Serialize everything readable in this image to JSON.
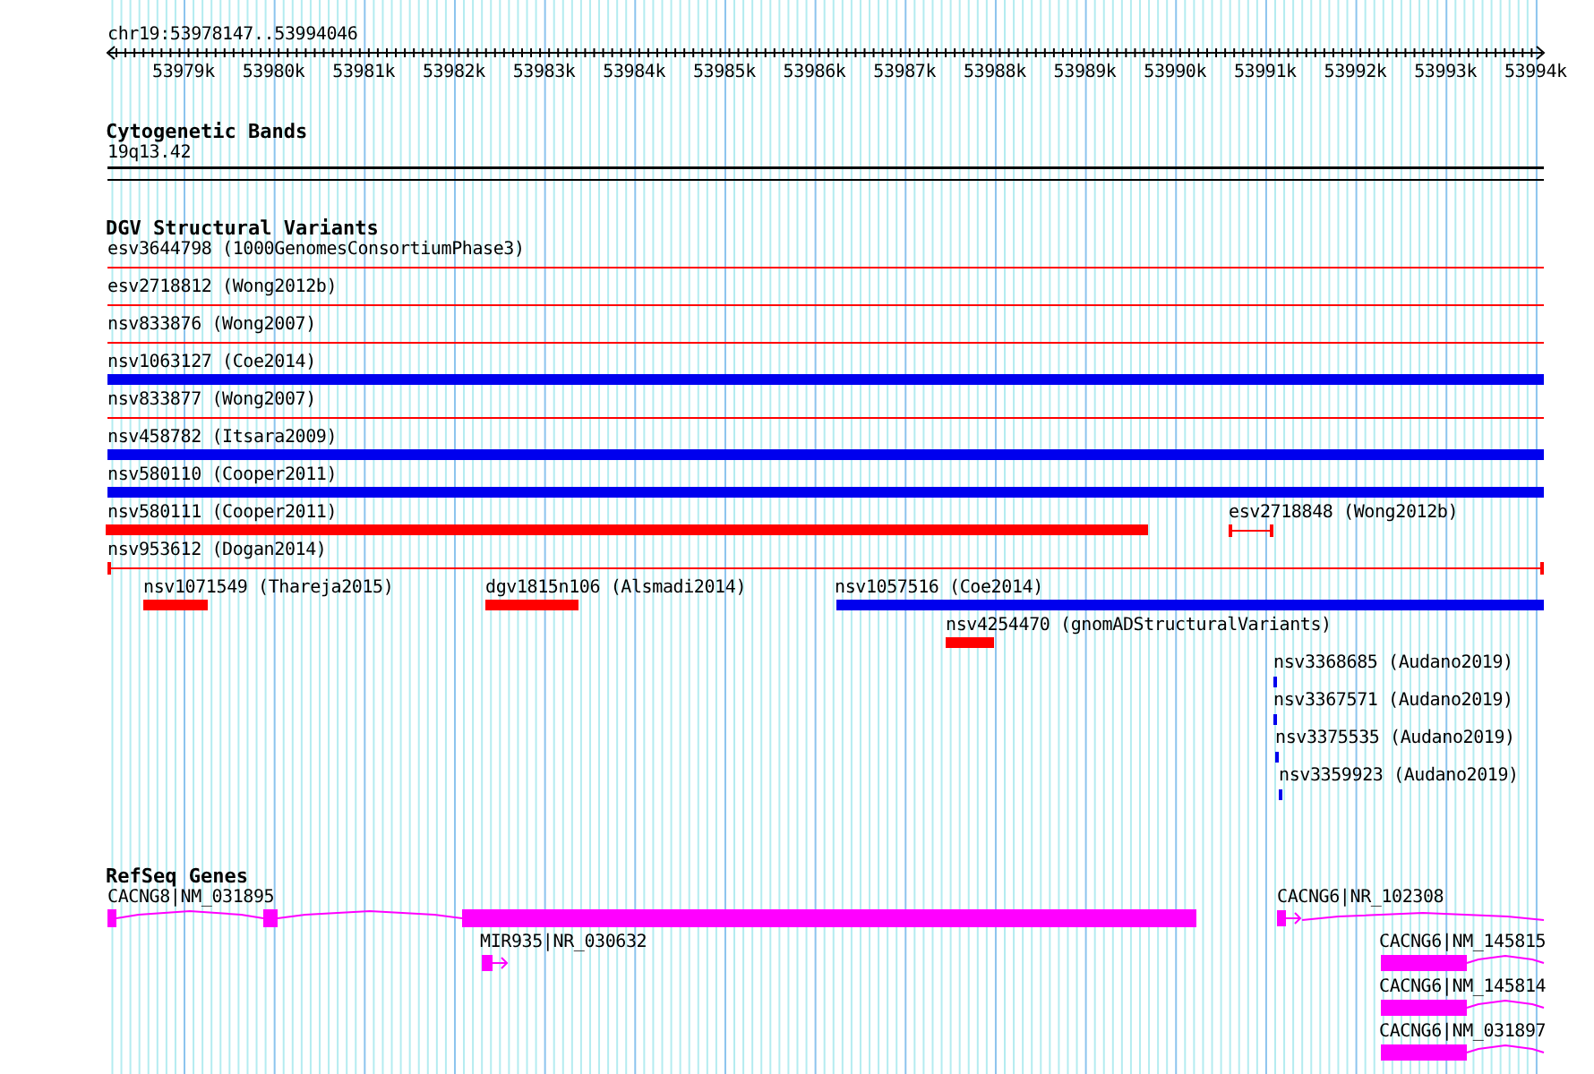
{
  "ruler": {
    "location": "chr19:53978147..53994046",
    "ticks": [
      "53979k",
      "53980k",
      "53981k",
      "53982k",
      "53983k",
      "53984k",
      "53985k",
      "53986k",
      "53987k",
      "53988k",
      "53989k",
      "53990k",
      "53991k",
      "53992k",
      "53993k",
      "53994k"
    ]
  },
  "cytogenetic_bands": {
    "title": "Cytogenetic Bands",
    "band": "19q13.42"
  },
  "dgv_structural_variants": {
    "title": "DGV Structural Variants",
    "features": [
      {
        "label": "esv3644798 (1000GenomesConsortiumPhase3)",
        "kind": "line",
        "color": "#ff0000"
      },
      {
        "label": "esv2718812 (Wong2012b)",
        "kind": "line",
        "color": "#ff0000"
      },
      {
        "label": "nsv833876 (Wong2007)",
        "kind": "line",
        "color": "#ff0000"
      },
      {
        "label": "nsv1063127 (Coe2014)",
        "kind": "bar",
        "color": "#0000ee"
      },
      {
        "label": "nsv833877 (Wong2007)",
        "kind": "line",
        "color": "#ff0000"
      },
      {
        "label": "nsv458782 (Itsara2009)",
        "kind": "bar",
        "color": "#0000ee"
      },
      {
        "label": "nsv580110 (Cooper2011)",
        "kind": "bar",
        "color": "#0000ee"
      },
      {
        "label": "nsv580111 (Cooper2011)",
        "kind": "bar",
        "color": "#ff0000"
      },
      {
        "label": "esv2718848 (Wong2012b)",
        "kind": "span",
        "color": "#ff0000"
      },
      {
        "label": "nsv953612 (Dogan2014)",
        "kind": "span",
        "color": "#ff0000"
      },
      {
        "label": "nsv1071549 (Thareja2015)",
        "kind": "bar",
        "color": "#ff0000"
      },
      {
        "label": "dgv1815n106 (Alsmadi2014)",
        "kind": "bar",
        "color": "#ff0000"
      },
      {
        "label": "nsv1057516 (Coe2014)",
        "kind": "bar",
        "color": "#0000ee"
      },
      {
        "label": "nsv4254470 (gnomADStructuralVariants)",
        "kind": "bar",
        "color": "#ff0000"
      },
      {
        "label": "nsv3368685 (Audano2019)",
        "kind": "tick",
        "color": "#0000ee"
      },
      {
        "label": "nsv3367571 (Audano2019)",
        "kind": "tick",
        "color": "#0000ee"
      },
      {
        "label": "nsv3375535 (Audano2019)",
        "kind": "tick",
        "color": "#0000ee"
      },
      {
        "label": "nsv3359923 (Audano2019)",
        "kind": "tick",
        "color": "#0000ee"
      }
    ]
  },
  "refseq_genes": {
    "title": "RefSeq Genes",
    "genes": [
      {
        "label": "CACNG8|NM_031895"
      },
      {
        "label": "MIR935|NR_030632"
      },
      {
        "label": "CACNG6|NR_102308"
      },
      {
        "label": "CACNG6|NM_145815"
      },
      {
        "label": "CACNG6|NM_145814"
      },
      {
        "label": "CACNG6|NM_031897"
      }
    ]
  }
}
